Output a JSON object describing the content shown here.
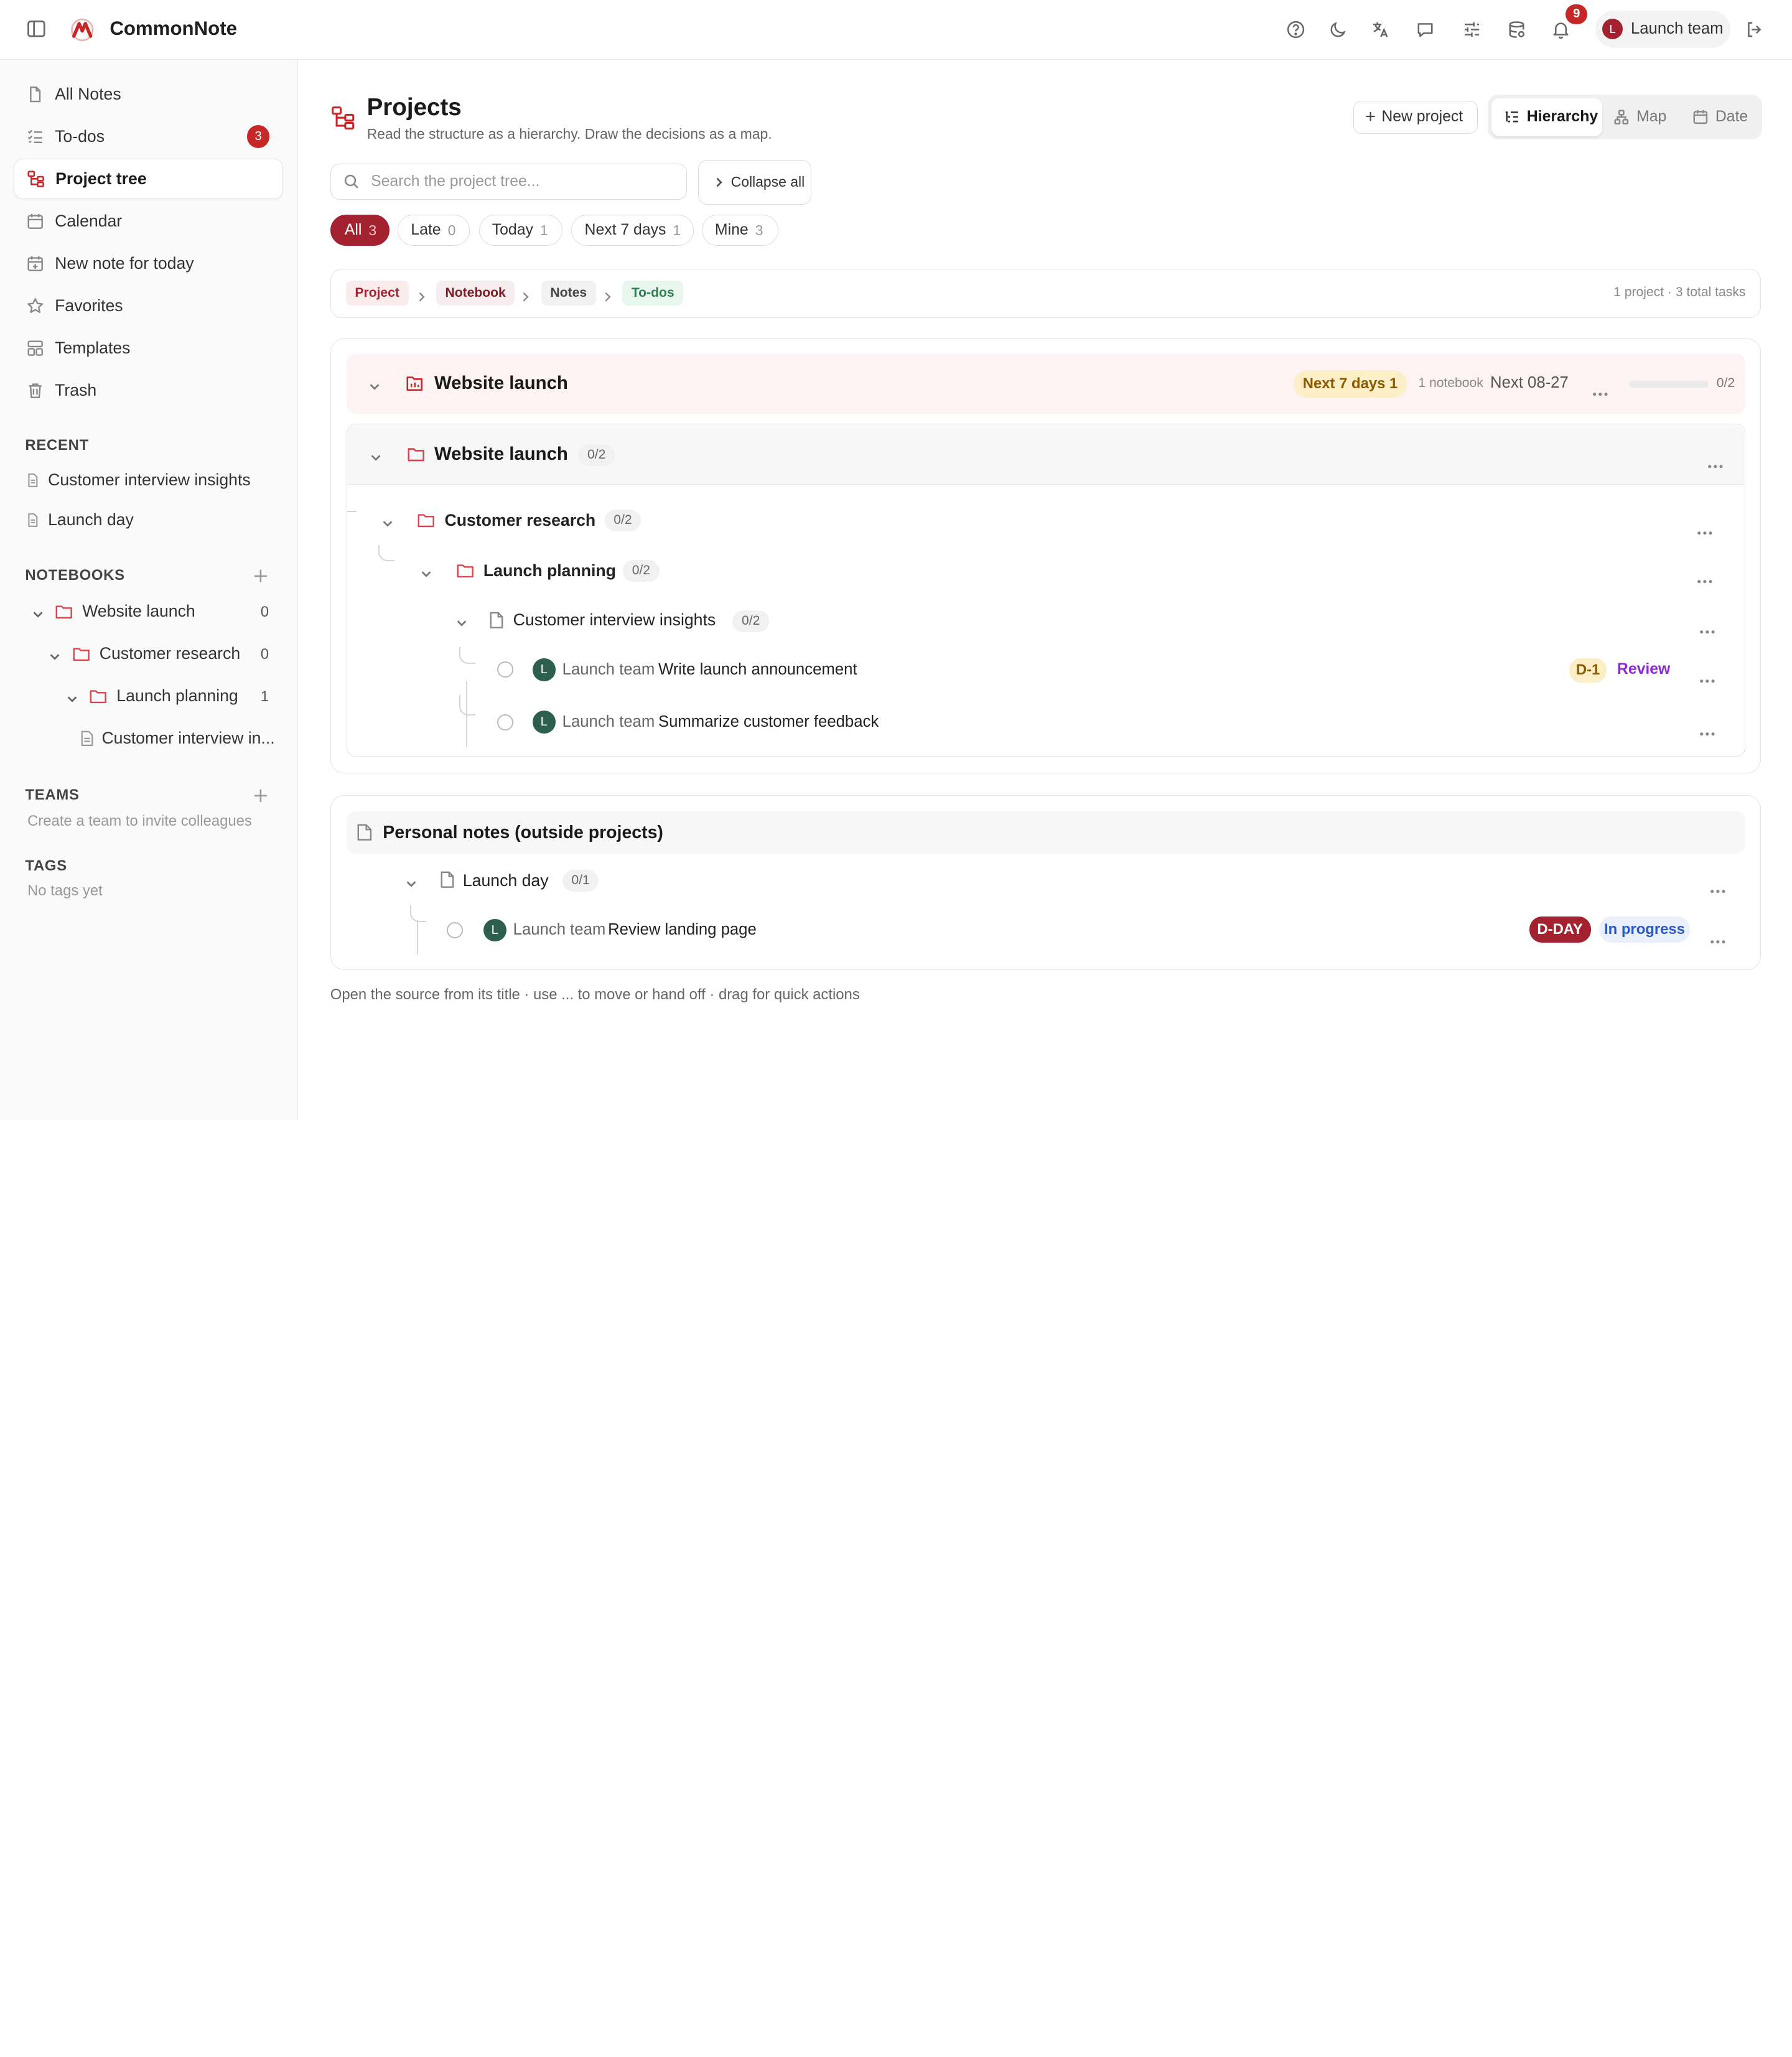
{
  "app": {
    "title": "CommonNote"
  },
  "colors": {
    "brand": "#c62828",
    "brand_dark": "#a4222f",
    "avatar_green": "#2e5e4e"
  },
  "topbar": {
    "icons": [
      "sidebar-toggle-icon",
      "help-icon",
      "moon-icon",
      "translate-icon",
      "chat-icon",
      "sliders-icon",
      "database-icon",
      "bell-icon",
      "logout-icon"
    ],
    "notifications": "9",
    "user": {
      "initial": "L",
      "name": "Launch team"
    }
  },
  "sidebar": {
    "nav": [
      {
        "label": "All Notes",
        "icon": "note-icon"
      },
      {
        "label": "To-dos",
        "icon": "checklist-icon",
        "count": "3"
      },
      {
        "label": "Project tree",
        "icon": "tree-icon"
      },
      {
        "label": "Calendar",
        "icon": "calendar-icon"
      },
      {
        "label": "New note for today",
        "icon": "calendar-plus-icon"
      },
      {
        "label": "Favorites",
        "icon": "star-icon"
      },
      {
        "label": "Templates",
        "icon": "template-icon"
      },
      {
        "label": "Trash",
        "icon": "trash-icon"
      }
    ],
    "recent_heading": "RECENT",
    "recent": [
      "Customer interview insights",
      "Launch day"
    ],
    "notebooks_heading": "NOTEBOOKS",
    "notebooks": [
      {
        "label": "Website launch",
        "count": "0"
      },
      {
        "label": "Customer research",
        "count": "0"
      },
      {
        "label": "Launch planning",
        "count": "1"
      },
      {
        "label": "Customer interview in..."
      }
    ],
    "teams_heading": "TEAMS",
    "teams_empty": "Create a team to invite colleagues",
    "tags_heading": "TAGS",
    "tags_empty": "No tags yet"
  },
  "page": {
    "title": "Projects",
    "subtitle": "Read the structure as a hierarchy. Draw the decisions as a map.",
    "new_project": "New project",
    "views": [
      "Hierarchy",
      "Map",
      "Date"
    ],
    "active_view": "Hierarchy",
    "search_placeholder": "Search the project tree...",
    "collapse_all": "Collapse all",
    "filters": [
      {
        "label": "All",
        "count": "3"
      },
      {
        "label": "Late",
        "count": "0"
      },
      {
        "label": "Today",
        "count": "1"
      },
      {
        "label": "Next 7 days",
        "count": "1"
      },
      {
        "label": "Mine",
        "count": "3"
      }
    ],
    "breadcrumb": [
      "Project",
      "Notebook",
      "Notes",
      "To-dos"
    ],
    "breadcrumb_meta": "1 project · 3 total tasks"
  },
  "project": {
    "name": "Website launch",
    "badge": "Next 7 days 1",
    "notebook_count": "1 notebook",
    "next_date": "Next 08-27",
    "progress_fraction": 0,
    "progress_label": "0/2",
    "notebook": {
      "name": "Website launch",
      "count": "0/2"
    },
    "folders": [
      {
        "name": "Customer research",
        "count": "0/2"
      },
      {
        "name": "Launch planning",
        "count": "0/2"
      }
    ],
    "note": {
      "name": "Customer interview insights",
      "count": "0/2"
    },
    "tasks": [
      {
        "owner_initial": "L",
        "owner": "Launch team",
        "title": "Write launch announcement",
        "due": "D-1",
        "status": "Review"
      },
      {
        "owner_initial": "L",
        "owner": "Launch team",
        "title": "Summarize customer feedback"
      }
    ]
  },
  "personal": {
    "heading": "Personal notes (outside projects)",
    "note": {
      "name": "Launch day",
      "count": "0/1"
    },
    "tasks": [
      {
        "owner_initial": "L",
        "owner": "Launch team",
        "title": "Review landing page",
        "due": "D-DAY",
        "status": "In progress"
      }
    ]
  },
  "footer_hint": "Open the source from its title · use ... to move or hand off · drag for quick actions"
}
